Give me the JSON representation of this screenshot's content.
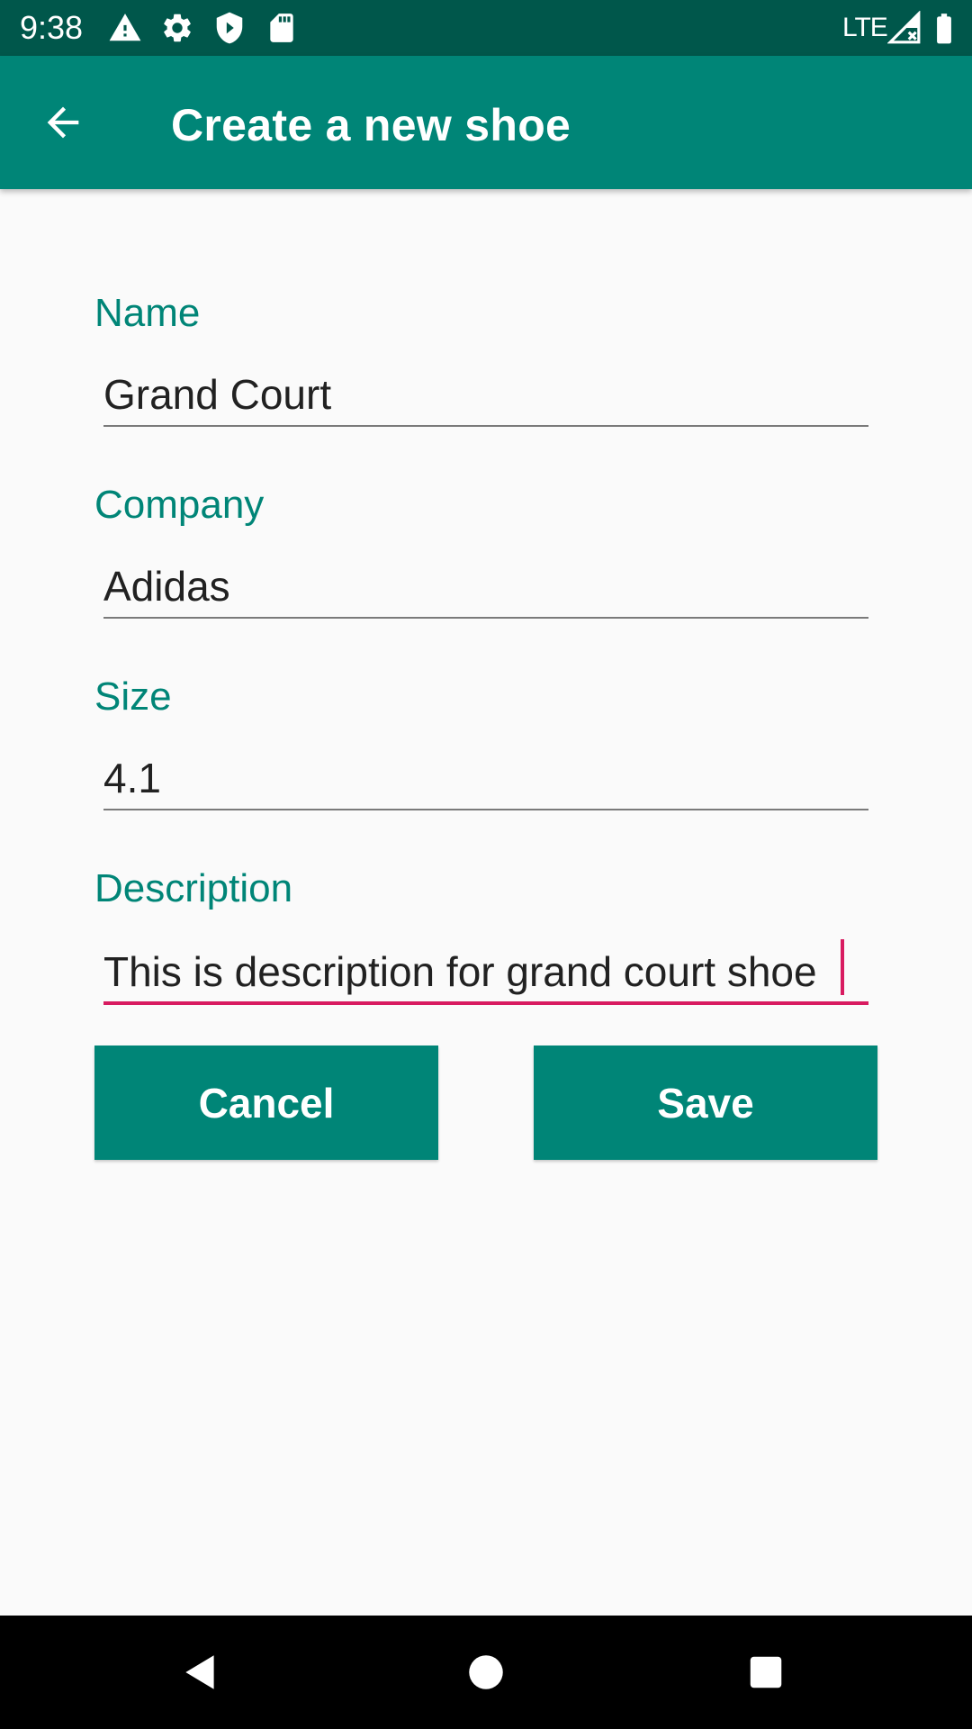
{
  "status_bar": {
    "time": "9:38",
    "network": "LTE",
    "icons": [
      "warning-icon",
      "gear-icon",
      "shield-icon",
      "sd-card-icon",
      "signal-icon",
      "battery-icon"
    ]
  },
  "app_bar": {
    "title": "Create a new shoe",
    "back_icon": "arrow-left-icon"
  },
  "form": {
    "name": {
      "label": "Name",
      "value": "Grand Court"
    },
    "company": {
      "label": "Company",
      "value": "Adidas"
    },
    "size": {
      "label": "Size",
      "value": "4.1"
    },
    "description": {
      "label": "Description",
      "value": "This is description for grand court shoe"
    }
  },
  "buttons": {
    "cancel_label": "Cancel",
    "save_label": "Save"
  },
  "nav": {
    "icons": [
      "back-triangle-icon",
      "home-circle-icon",
      "recents-square-icon"
    ]
  },
  "colors": {
    "primary": "#008577",
    "primary_dark": "#00574b",
    "accent": "#d81b60",
    "background": "#fafafa"
  }
}
